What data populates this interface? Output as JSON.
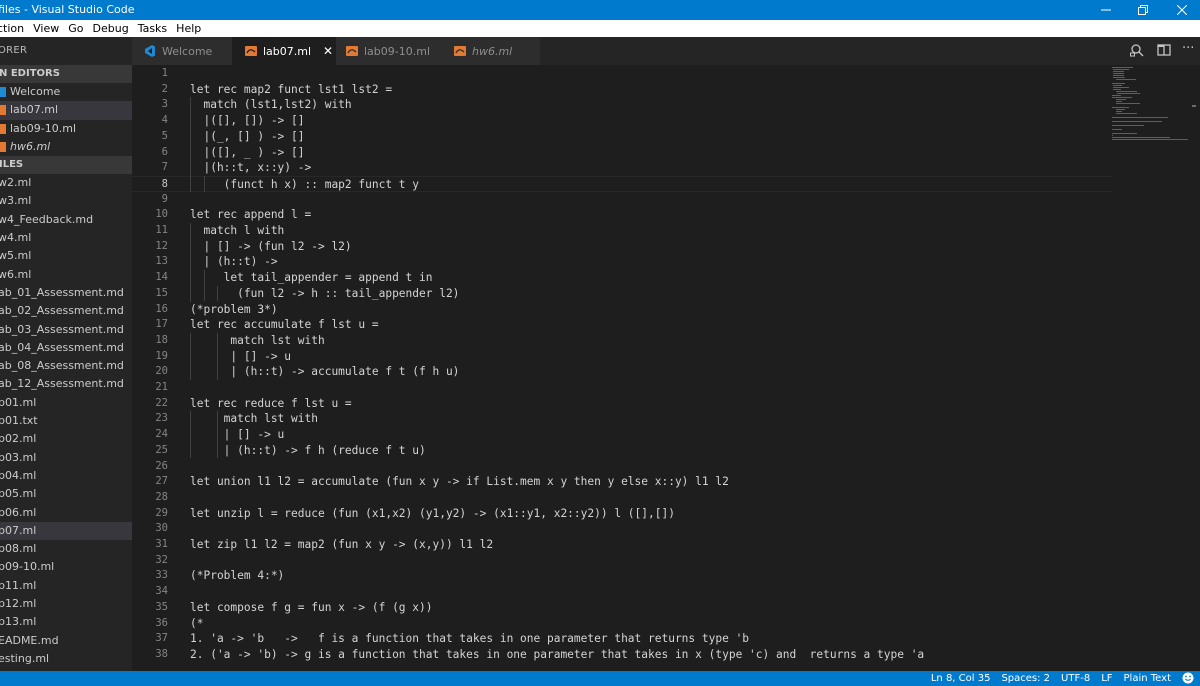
{
  "window": {
    "title": "files - Visual Studio Code",
    "minimize_label": "—",
    "restore_label": "❐",
    "close_label": "✕"
  },
  "menu": [
    "ction",
    "View",
    "Go",
    "Debug",
    "Tasks",
    "Help"
  ],
  "sidebar": {
    "header": "ORER",
    "open_editors_label": "N EDITORS",
    "open_editors": [
      {
        "label": "Welcome",
        "icon": "vscode-icon",
        "italic": false,
        "selected": false
      },
      {
        "label": "lab07.ml",
        "icon": "ocaml-icon",
        "italic": false,
        "selected": true
      },
      {
        "label": "lab09-10.ml",
        "icon": "ocaml-icon",
        "italic": false,
        "selected": false
      },
      {
        "label": "hw6.ml",
        "icon": "ocaml-icon",
        "italic": true,
        "selected": false
      }
    ],
    "files_label": "ILES",
    "files": [
      {
        "label": "w2.ml",
        "selected": false
      },
      {
        "label": "w3.ml",
        "selected": false
      },
      {
        "label": "w4_Feedback.md",
        "selected": false
      },
      {
        "label": "w4.ml",
        "selected": false
      },
      {
        "label": "w5.ml",
        "selected": false
      },
      {
        "label": "w6.ml",
        "selected": false
      },
      {
        "label": "ab_01_Assessment.md",
        "selected": false
      },
      {
        "label": "ab_02_Assessment.md",
        "selected": false
      },
      {
        "label": "ab_03_Assessment.md",
        "selected": false
      },
      {
        "label": "ab_04_Assessment.md",
        "selected": false
      },
      {
        "label": "ab_08_Assessment.md",
        "selected": false
      },
      {
        "label": "ab_12_Assessment.md",
        "selected": false
      },
      {
        "label": "b01.ml",
        "selected": false
      },
      {
        "label": "b01.txt",
        "selected": false
      },
      {
        "label": "b02.ml",
        "selected": false
      },
      {
        "label": "b03.ml",
        "selected": false
      },
      {
        "label": "b04.ml",
        "selected": false
      },
      {
        "label": "b05.ml",
        "selected": false
      },
      {
        "label": "b06.ml",
        "selected": false
      },
      {
        "label": "b07.ml",
        "selected": true
      },
      {
        "label": "b08.ml",
        "selected": false
      },
      {
        "label": "b09-10.ml",
        "selected": false
      },
      {
        "label": "b11.ml",
        "selected": false
      },
      {
        "label": "b12.ml",
        "selected": false
      },
      {
        "label": "b13.ml",
        "selected": false
      },
      {
        "label": "EADME.md",
        "selected": false
      },
      {
        "label": "esting.ml",
        "selected": false
      }
    ]
  },
  "tabs": [
    {
      "label": "Welcome",
      "icon": "vscode-icon",
      "active": false,
      "italic": false
    },
    {
      "label": "lab07.ml",
      "icon": "ocaml-icon",
      "active": true,
      "italic": false,
      "close": "✕"
    },
    {
      "label": "lab09-10.ml",
      "icon": "ocaml-icon",
      "active": false,
      "italic": false
    },
    {
      "label": "hw6.ml",
      "icon": "ocaml-icon",
      "active": false,
      "italic": true
    }
  ],
  "editor": {
    "current_line": 8,
    "lines": [
      {
        "n": "1",
        "text": ""
      },
      {
        "n": "2",
        "text": "let rec map2 funct lst1 lst2 ="
      },
      {
        "n": "3",
        "text": "  match (lst1,lst2) with"
      },
      {
        "n": "4",
        "text": "  |([], []) -> []"
      },
      {
        "n": "5",
        "text": "  |(_, [] ) -> []"
      },
      {
        "n": "6",
        "text": "  |([], _ ) -> []"
      },
      {
        "n": "7",
        "text": "  |(h::t, x::y) ->"
      },
      {
        "n": "8",
        "text": "     (funct h x) :: map2 funct t y"
      },
      {
        "n": "9",
        "text": ""
      },
      {
        "n": "10",
        "text": "let rec append l ="
      },
      {
        "n": "11",
        "text": "  match l with"
      },
      {
        "n": "12",
        "text": "  | [] -> (fun l2 -> l2)"
      },
      {
        "n": "13",
        "text": "  | (h::t) ->"
      },
      {
        "n": "14",
        "text": "     let tail_appender = append t in"
      },
      {
        "n": "15",
        "text": "       (fun l2 -> h :: tail_appender l2)"
      },
      {
        "n": "16",
        "text": "(*problem 3*)"
      },
      {
        "n": "17",
        "text": "let rec accumulate f lst u ="
      },
      {
        "n": "18",
        "text": "      match lst with"
      },
      {
        "n": "19",
        "text": "      | [] -> u"
      },
      {
        "n": "20",
        "text": "      | (h::t) -> accumulate f t (f h u)"
      },
      {
        "n": "21",
        "text": ""
      },
      {
        "n": "22",
        "text": "let rec reduce f lst u ="
      },
      {
        "n": "23",
        "text": "     match lst with"
      },
      {
        "n": "24",
        "text": "     | [] -> u"
      },
      {
        "n": "25",
        "text": "     | (h::t) -> f h (reduce f t u)"
      },
      {
        "n": "26",
        "text": ""
      },
      {
        "n": "27",
        "text": "let union l1 l2 = accumulate (fun x y -> if List.mem x y then y else x::y) l1 l2"
      },
      {
        "n": "28",
        "text": ""
      },
      {
        "n": "29",
        "text": "let unzip l = reduce (fun (x1,x2) (y1,y2) -> (x1::y1, x2::y2)) l ([],[])"
      },
      {
        "n": "30",
        "text": ""
      },
      {
        "n": "31",
        "text": "let zip l1 l2 = map2 (fun x y -> (x,y)) l1 l2"
      },
      {
        "n": "32",
        "text": ""
      },
      {
        "n": "33",
        "text": "(*Problem 4:*)"
      },
      {
        "n": "34",
        "text": ""
      },
      {
        "n": "35",
        "text": "let compose f g = fun x -> (f (g x))"
      },
      {
        "n": "36",
        "text": "(*"
      },
      {
        "n": "37",
        "text": "1. 'a -> 'b   ->   f is a function that takes in one parameter that returns type 'b"
      },
      {
        "n": "38",
        "text": "2. ('a -> 'b) -> g is a function that takes in one parameter that takes in x (type 'c) and  returns a type 'a"
      }
    ]
  },
  "statusbar": {
    "position": "Ln 8, Col 35",
    "spaces": "Spaces: 2",
    "encoding": "UTF-8",
    "eol": "LF",
    "language": "Plain Text",
    "feedback_icon": "smiley-icon"
  },
  "colors": {
    "accent": "#007acc",
    "editor_bg": "#1e1e1e",
    "sidebar_bg": "#252526",
    "ocaml_icon": "#e37933",
    "vscode_icon": "#1f8ad2"
  }
}
